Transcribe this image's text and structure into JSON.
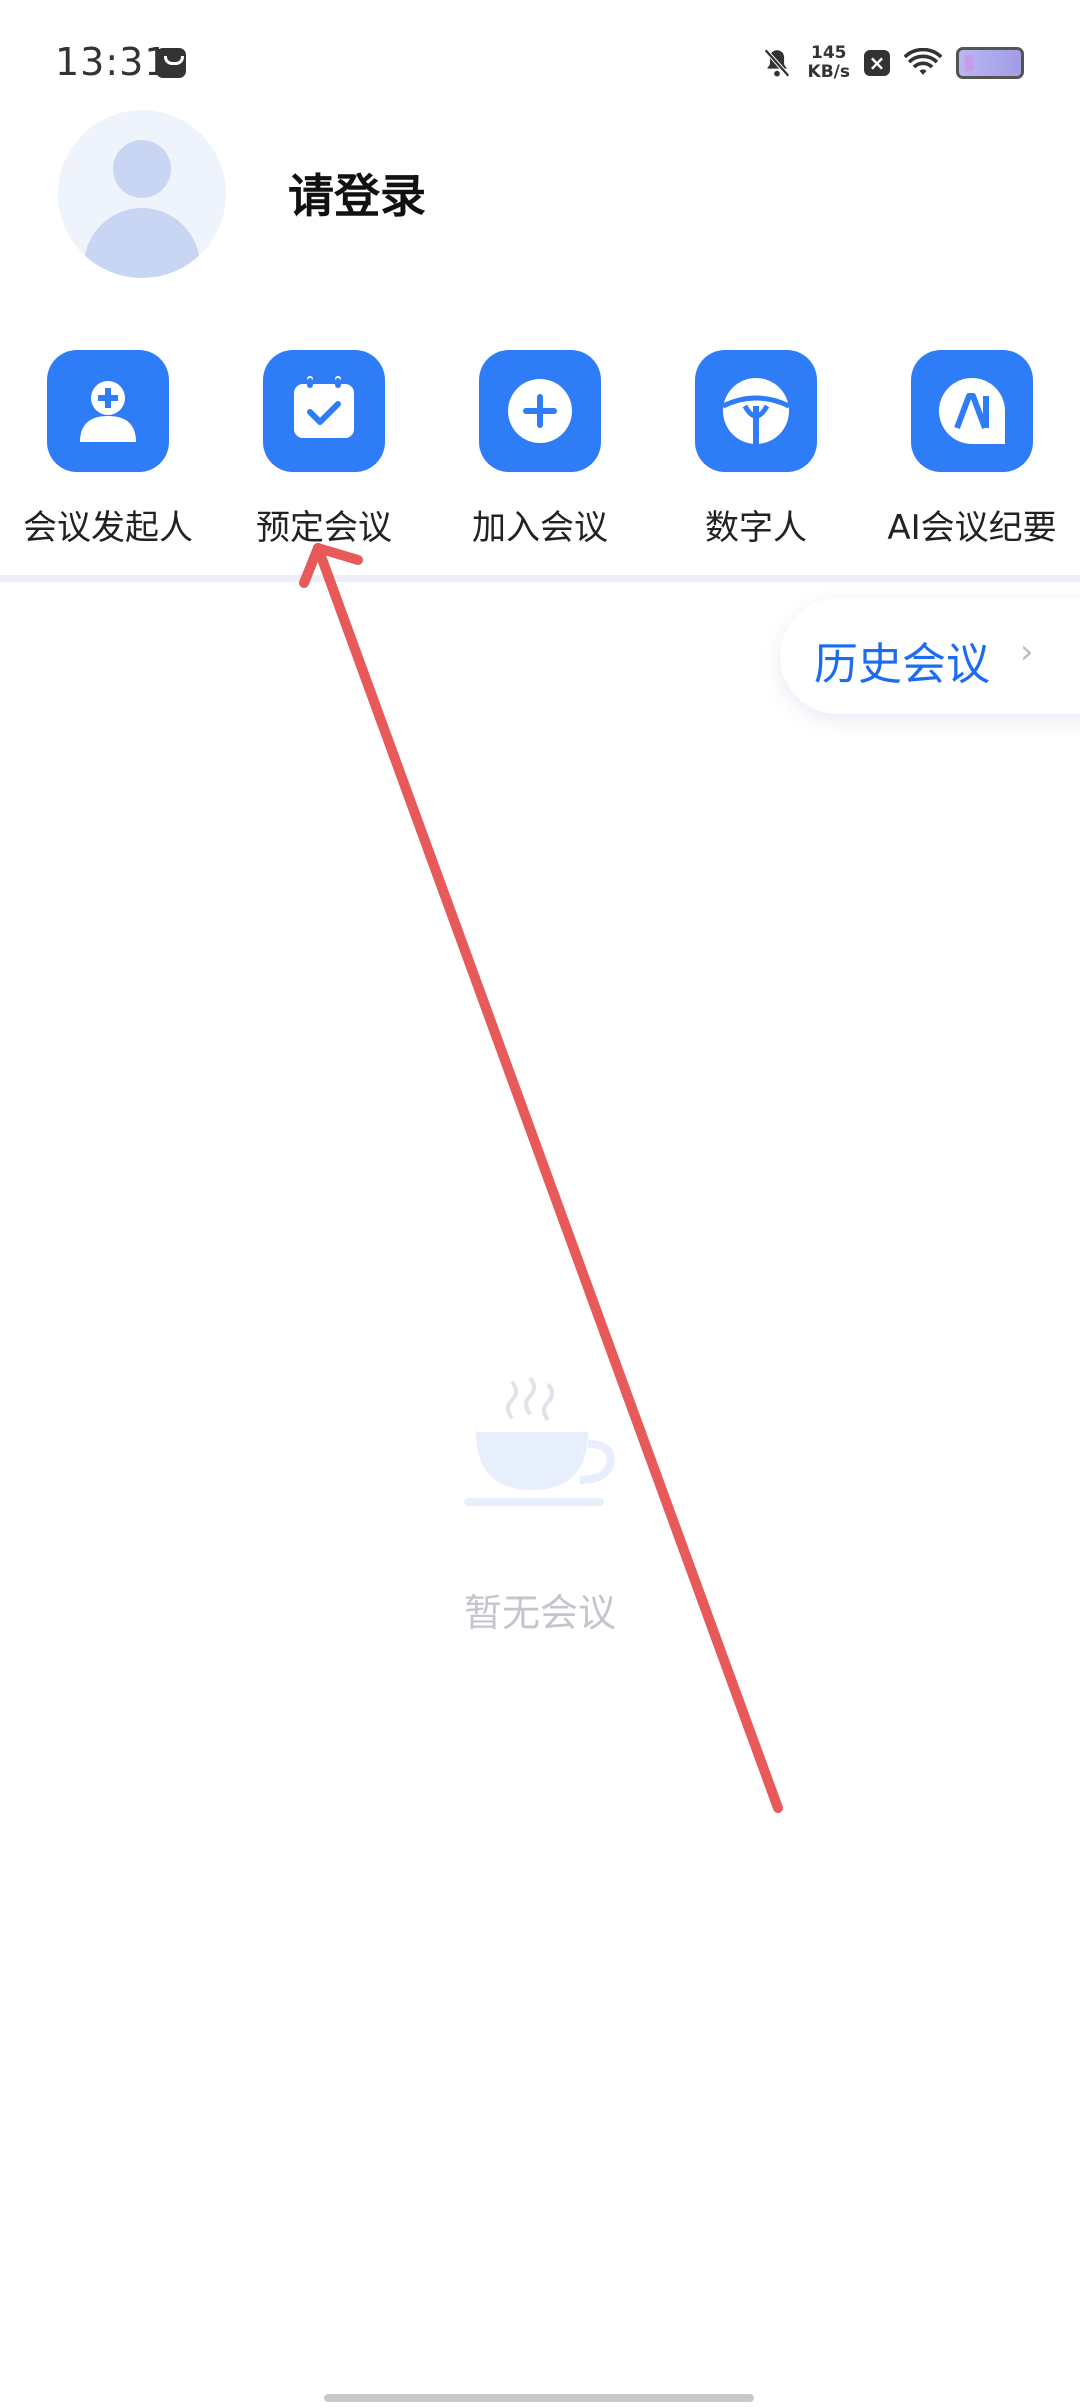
{
  "status_bar": {
    "time": "13:31",
    "speed_value": "145",
    "speed_unit": "KB/s"
  },
  "profile": {
    "login_text": "请登录"
  },
  "features": [
    {
      "label": "会议发起人",
      "icon": "person-add-icon"
    },
    {
      "label": "预定会议",
      "icon": "calendar-check-icon"
    },
    {
      "label": "加入会议",
      "icon": "plus-circle-icon"
    },
    {
      "label": "数字人",
      "icon": "digital-human-icon"
    },
    {
      "label": "AI会议纪要",
      "icon": "ai-icon"
    }
  ],
  "history": {
    "label": "历史会议"
  },
  "empty_state": {
    "text": "暂无会议",
    "icon": "coffee-cup-icon"
  },
  "colors": {
    "primary": "#2e7cf6",
    "arrow": "#e85a5a"
  }
}
